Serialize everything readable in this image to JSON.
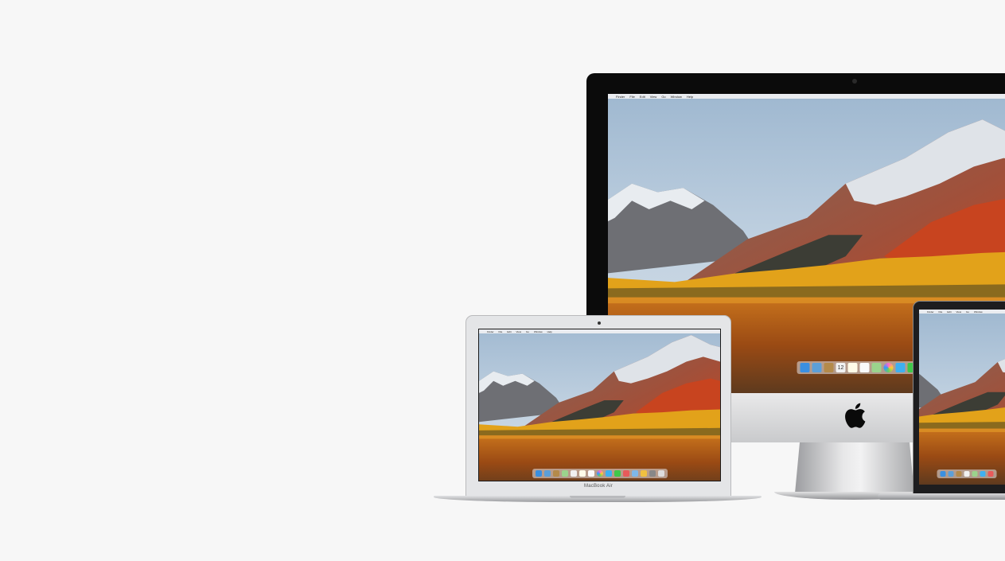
{
  "imac": {
    "menu": [
      "",
      "Finder",
      "File",
      "Edit",
      "View",
      "Go",
      "Window",
      "Help"
    ],
    "dock_date": "12"
  },
  "macbook_air": {
    "label": "MacBook Air",
    "menu": [
      "",
      "Finder",
      "File",
      "Edit",
      "View",
      "Go",
      "Window",
      "Help"
    ]
  },
  "macbook_pro": {
    "menu": [
      "",
      "Finder",
      "File",
      "Edit",
      "View",
      "Go",
      "Window"
    ]
  },
  "colors": {
    "background": "#f7f7f7",
    "sky": "#a9c2d8",
    "foliage": "#e2a21a",
    "slope": "#c8441f"
  },
  "icons": [
    "apple-logo-icon",
    "camera-icon"
  ]
}
